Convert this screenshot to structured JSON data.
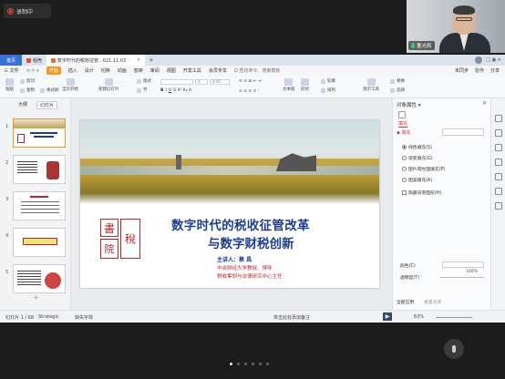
{
  "recording": {
    "label": "录制中"
  },
  "video": {
    "participant_name": "董光辉"
  },
  "app": {
    "tabs": [
      {
        "label": "首页"
      },
      {
        "label": "稻壳"
      },
      {
        "label": "数字时代的税收征管...021.11.03"
      }
    ],
    "top_right": {
      "user": "",
      "icons": "□ ▣ ✕"
    },
    "menu": {
      "file": "三 文件",
      "items": [
        "开始",
        "插入",
        "设计",
        "切换",
        "动画",
        "放映",
        "审阅",
        "视图",
        "开发工具",
        "会员专享"
      ],
      "search": "Q 查找命令、搜索模板",
      "right": [
        "未同步",
        "协作",
        "分享"
      ]
    },
    "toolbar": {
      "paste": "粘贴",
      "cut": "剪切",
      "copy": "复制",
      "format_painter": "格式刷",
      "from_current": "当页开始",
      "new_slide": "新建幻灯片",
      "layout": "版式",
      "section": "节",
      "reset": "重置",
      "font_size": "0",
      "line_spacing": "0.05",
      "text_box": "文本框",
      "shape": "形状",
      "arrange": "排列",
      "outline": "轮廓",
      "present_tool": "演示工具",
      "replace": "替换",
      "select": "选择"
    },
    "left_panel": {
      "tabs": [
        "大纲",
        "幻灯片"
      ],
      "slide_numbers": [
        "1",
        "2",
        "3",
        "4",
        "5"
      ]
    },
    "slide": {
      "title_line1": "数字时代的税收征管改革",
      "title_line2": "与数字财税创新",
      "speaker": "主讲人：蔡 昌",
      "affiliation1": "中央财经大学教授、博导",
      "affiliation2": "税收筹划与法律研究中心主任",
      "seal_chars": [
        "稅",
        "書",
        "院"
      ]
    },
    "right_panel": {
      "title": "对象属性 ▾",
      "fill_tab": "填充",
      "fill_section": "◆ 填充",
      "options": [
        "纯色填充(S)",
        "渐变填充(G)",
        "图片或纹理填充(P)",
        "图案填充(A)"
      ],
      "hide_bg": "隐藏背景图形(H)",
      "color_label": "颜色(C)",
      "transparency_label": "透明度(T)",
      "transparency_value": "100%",
      "apply_all": "全部应用",
      "reset_bg": "重置背景"
    },
    "status": {
      "page": "幻灯片 1 / 68",
      "theme": "Strategic",
      "missing_font": "缺失字体",
      "notes": "单击此处添加备注",
      "zoom": "63%"
    }
  },
  "pagination": {
    "count": 6,
    "active": 0
  }
}
